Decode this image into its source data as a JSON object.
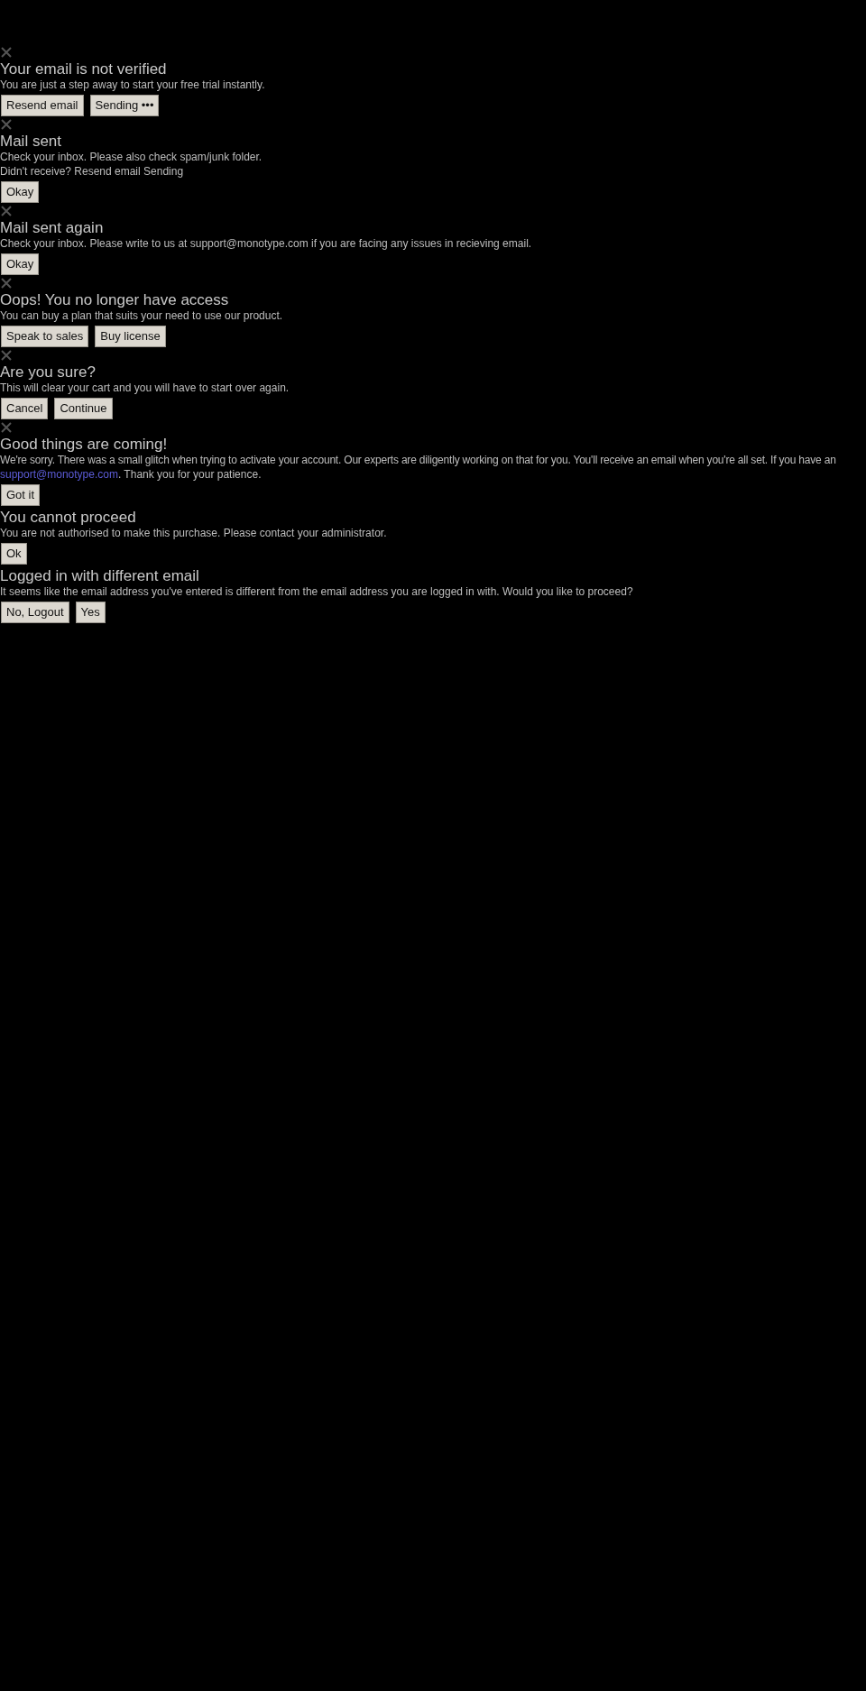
{
  "dialogs": [
    {
      "closable": true,
      "title": "Your email is not verified",
      "message": "You are just a step away to start your free trial instantly.",
      "buttons": [
        "Resend email",
        "Sending •••"
      ]
    },
    {
      "closable": true,
      "title": "Mail sent",
      "message": "Check your inbox. Please also check spam/junk folder.",
      "note": "Didn't receive? Resend email Sending",
      "buttons": [
        "Okay"
      ]
    },
    {
      "closable": true,
      "title": "Mail sent again",
      "message": "Check your inbox. Please write to us at support@monotype.com if you are facing any issues in recieving email.",
      "buttons": [
        "Okay"
      ]
    },
    {
      "closable": true,
      "title": "Oops! You no longer have access",
      "message": "You can buy a plan that suits your need to use our product.",
      "buttons": [
        "Speak to sales",
        "Buy license"
      ]
    },
    {
      "closable": true,
      "title": "Are you sure?",
      "message": "This will clear your cart and you will have to start over again.",
      "buttons": [
        "Cancel",
        "Continue"
      ]
    },
    {
      "closable": true,
      "title": "Good things are coming!",
      "message": "We're sorry. There was a small glitch when trying to activate your account. Our experts are diligently working on that for you. You'll receive an email when you're all set. If you have an",
      "link": "support@monotype.com",
      "after": ". Thank you for your patience.",
      "buttons": [
        "Got it"
      ]
    },
    {
      "closable": false,
      "title": "You cannot proceed",
      "message": "You are not authorised to make this purchase. Please contact your administrator.",
      "buttons": [
        "Ok"
      ]
    },
    {
      "closable": false,
      "title": "Logged in with different email",
      "message": "It seems like the email address you've entered is different from the email address you are logged in with. Would you like to proceed?",
      "buttons": [
        "No, Logout",
        "Yes"
      ]
    }
  ]
}
